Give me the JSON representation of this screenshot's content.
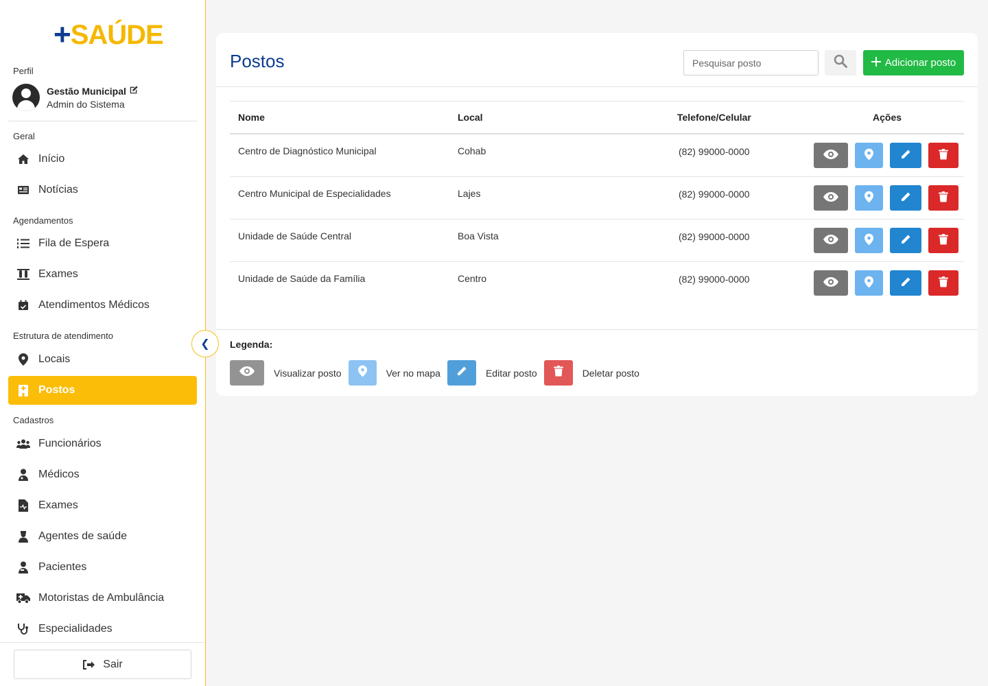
{
  "app": {
    "logo_plus": "+",
    "logo_text": "SAÚDE"
  },
  "sidebar": {
    "profile_label": "Perfil",
    "profile": {
      "name": "Gestão Municipal",
      "role": "Admin do Sistema"
    },
    "sections": {
      "geral": "Geral",
      "agendamentos": "Agendamentos",
      "estrutura": "Estrutura de atendimento",
      "cadastros": "Cadastros"
    },
    "items": {
      "inicio": "Início",
      "noticias": "Notícias",
      "fila": "Fila de Espera",
      "exames_ag": "Exames",
      "atendimentos": "Atendimentos Médicos",
      "locais": "Locais",
      "postos": "Postos",
      "funcionarios": "Funcionários",
      "medicos": "Médicos",
      "exames_cad": "Exames",
      "agentes": "Agentes de saúde",
      "pacientes": "Pacientes",
      "motoristas": "Motoristas de Ambulância",
      "especialidades": "Especialidades"
    },
    "logout": "Sair",
    "collapse_glyph": "❮"
  },
  "main": {
    "title": "Postos",
    "search_placeholder": "Pesquisar posto",
    "add_button": "Adicionar posto",
    "columns": {
      "nome": "Nome",
      "local": "Local",
      "telefone": "Telefone/Celular",
      "acoes": "Ações"
    },
    "rows": [
      {
        "nome": "Centro de Diagnóstico Municipal",
        "local": "Cohab",
        "telefone": "(82) 99000-0000"
      },
      {
        "nome": "Centro Municipal de Especialidades",
        "local": "Lajes",
        "telefone": "(82) 99000-0000"
      },
      {
        "nome": "Unidade de Saúde Central",
        "local": "Boa Vista",
        "telefone": "(82) 99000-0000"
      },
      {
        "nome": "Unidade de Saúde da Família",
        "local": "Centro",
        "telefone": "(82) 99000-0000"
      }
    ],
    "legend": {
      "title": "Legenda:",
      "view": "Visualizar posto",
      "map": "Ver no mapa",
      "edit": "Editar posto",
      "delete": "Deletar posto"
    }
  },
  "colors": {
    "brand_blue": "#0d3c8f",
    "brand_yellow": "#fbbd08",
    "add_green": "#21ba45",
    "view_grey": "#767676",
    "map_lightblue": "#6cb3ef",
    "edit_blue": "#2185d0",
    "delete_red": "#db2828"
  }
}
